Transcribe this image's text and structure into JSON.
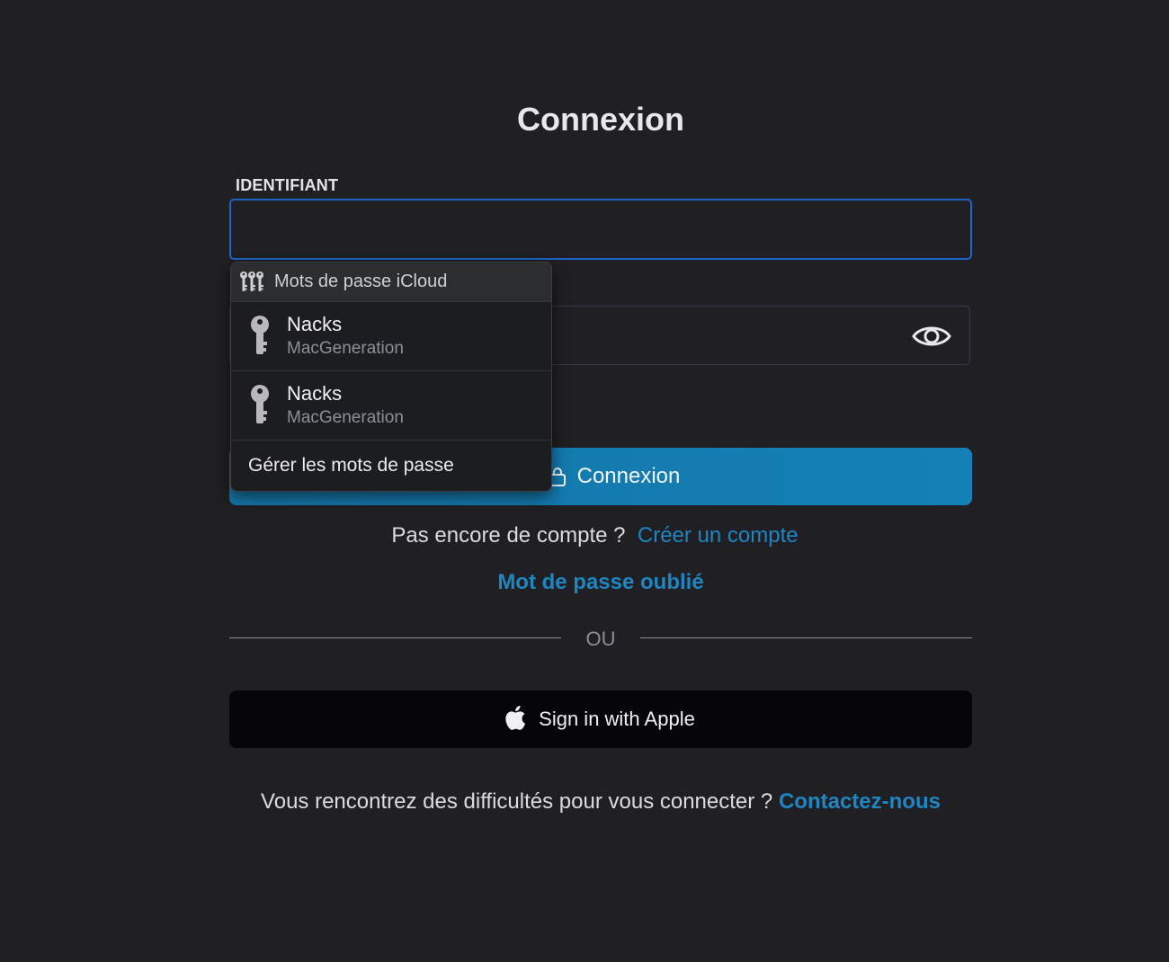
{
  "page": {
    "title": "Connexion"
  },
  "form": {
    "username_label": "IDENTIFIANT",
    "username_value": "",
    "password_value": "",
    "login_button": "Connexion"
  },
  "signup": {
    "question": "Pas encore de compte ?",
    "link": "Créer un compte"
  },
  "forgot_password": "Mot de passe oublié",
  "divider_text": "OU",
  "apple_button": "Sign in with Apple",
  "help": {
    "question": "Vous rencontrez des difficultés pour vous connecter ?",
    "link": "Contactez-nous"
  },
  "autofill": {
    "header": "Mots de passe iCloud",
    "items": [
      {
        "name": "Nacks",
        "site": "MacGeneration"
      },
      {
        "name": "Nacks",
        "site": "MacGeneration"
      }
    ],
    "manage": "Gérer les mots de passe"
  },
  "colors": {
    "background": "#1f1f24",
    "accent": "#1380b6",
    "link": "#1f86c2",
    "focus_border": "#1d64c8"
  },
  "icons": {
    "password_toggle": "eye-icon",
    "login": "lock-icon",
    "apple": "apple-logo-icon",
    "autofill_header": "keys-icon",
    "autofill_item": "key-icon"
  }
}
